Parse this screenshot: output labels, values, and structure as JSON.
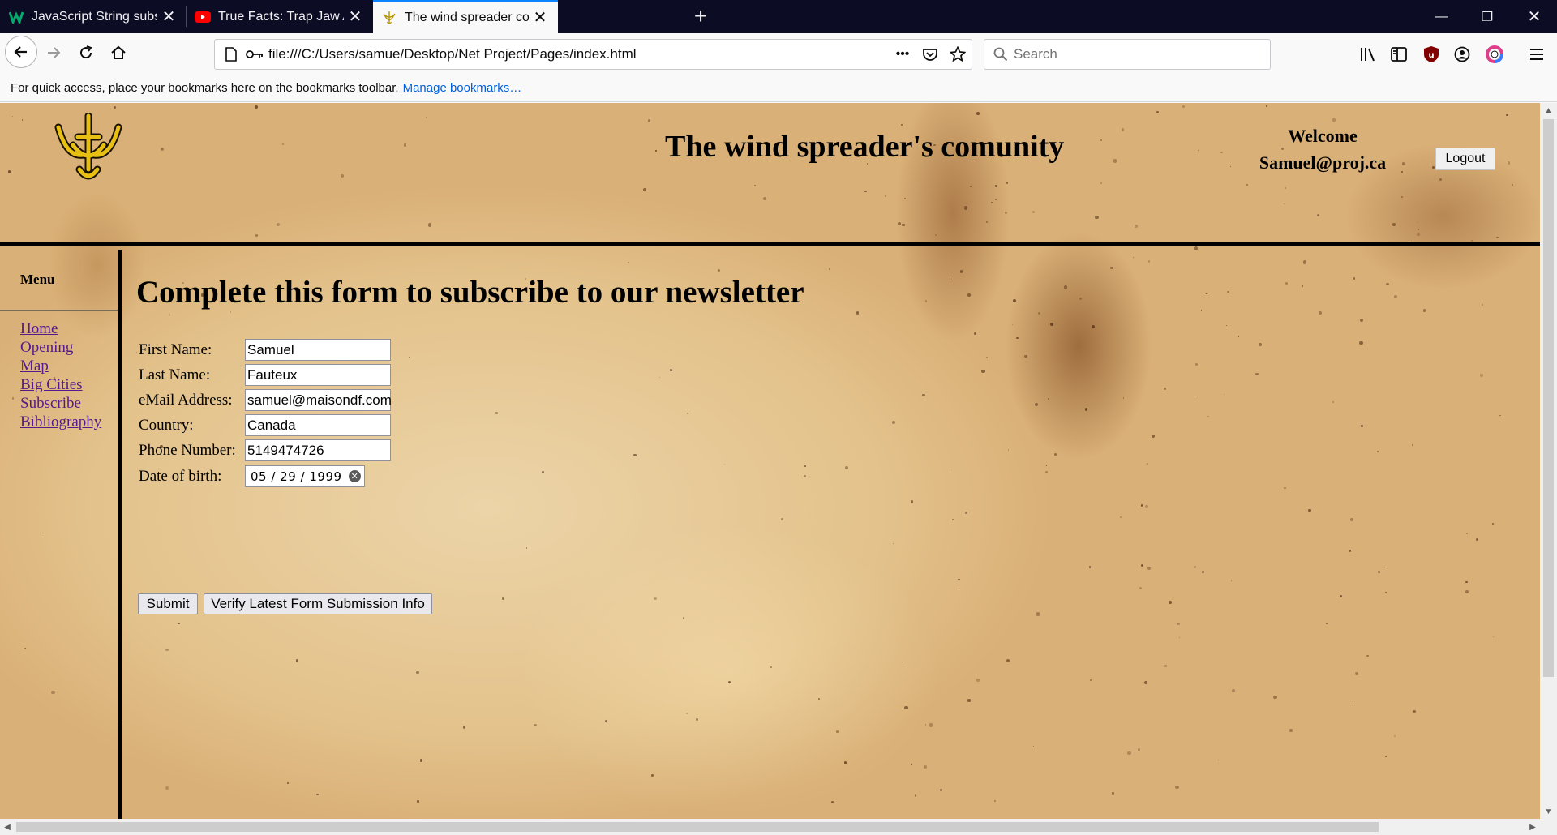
{
  "browser": {
    "tabs": [
      {
        "title": "JavaScript String substring() Me",
        "favicon": "w3schools-icon",
        "active": false
      },
      {
        "title": "True Facts: Trap Jaw Ants - YouT",
        "favicon": "youtube-icon",
        "active": false
      },
      {
        "title": "The wind spreader comunity",
        "favicon": "site-logo-icon",
        "active": true
      }
    ],
    "new_tab": "+",
    "url": "file:///C:/Users/samue/Desktop/Net Project/Pages/index.html",
    "search_placeholder": "Search",
    "bookmarks_message": "For quick access, place your bookmarks here on the bookmarks toolbar.",
    "bookmarks_link": "Manage bookmarks…",
    "accent": "#0a84ff"
  },
  "page": {
    "site_title": "The wind spreader's comunity",
    "welcome_line": "Welcome",
    "user_email": "Samuel@proj.ca",
    "logout_label": "Logout",
    "menu_title": "Menu",
    "menu_items": [
      "Home",
      "Opening",
      "Map",
      "Big Cities",
      "Subscribe",
      "Bibliography"
    ],
    "form_title": "Complete this form to subscribe to our newsletter",
    "fields": [
      {
        "label": "First Name:",
        "value": "Samuel"
      },
      {
        "label": "Last Name:",
        "value": "Fauteux"
      },
      {
        "label": "eMail Address:",
        "value": "samuel@maisondf.com"
      },
      {
        "label": "Country:",
        "value": "Canada"
      },
      {
        "label": "Phone Number:",
        "value": "5149474726"
      },
      {
        "label": "Date of birth:",
        "value": "05 / 29 / 1999"
      }
    ],
    "submit_label": "Submit",
    "verify_label": "Verify Latest Form Submission Info",
    "link_color": "#551a8b"
  }
}
